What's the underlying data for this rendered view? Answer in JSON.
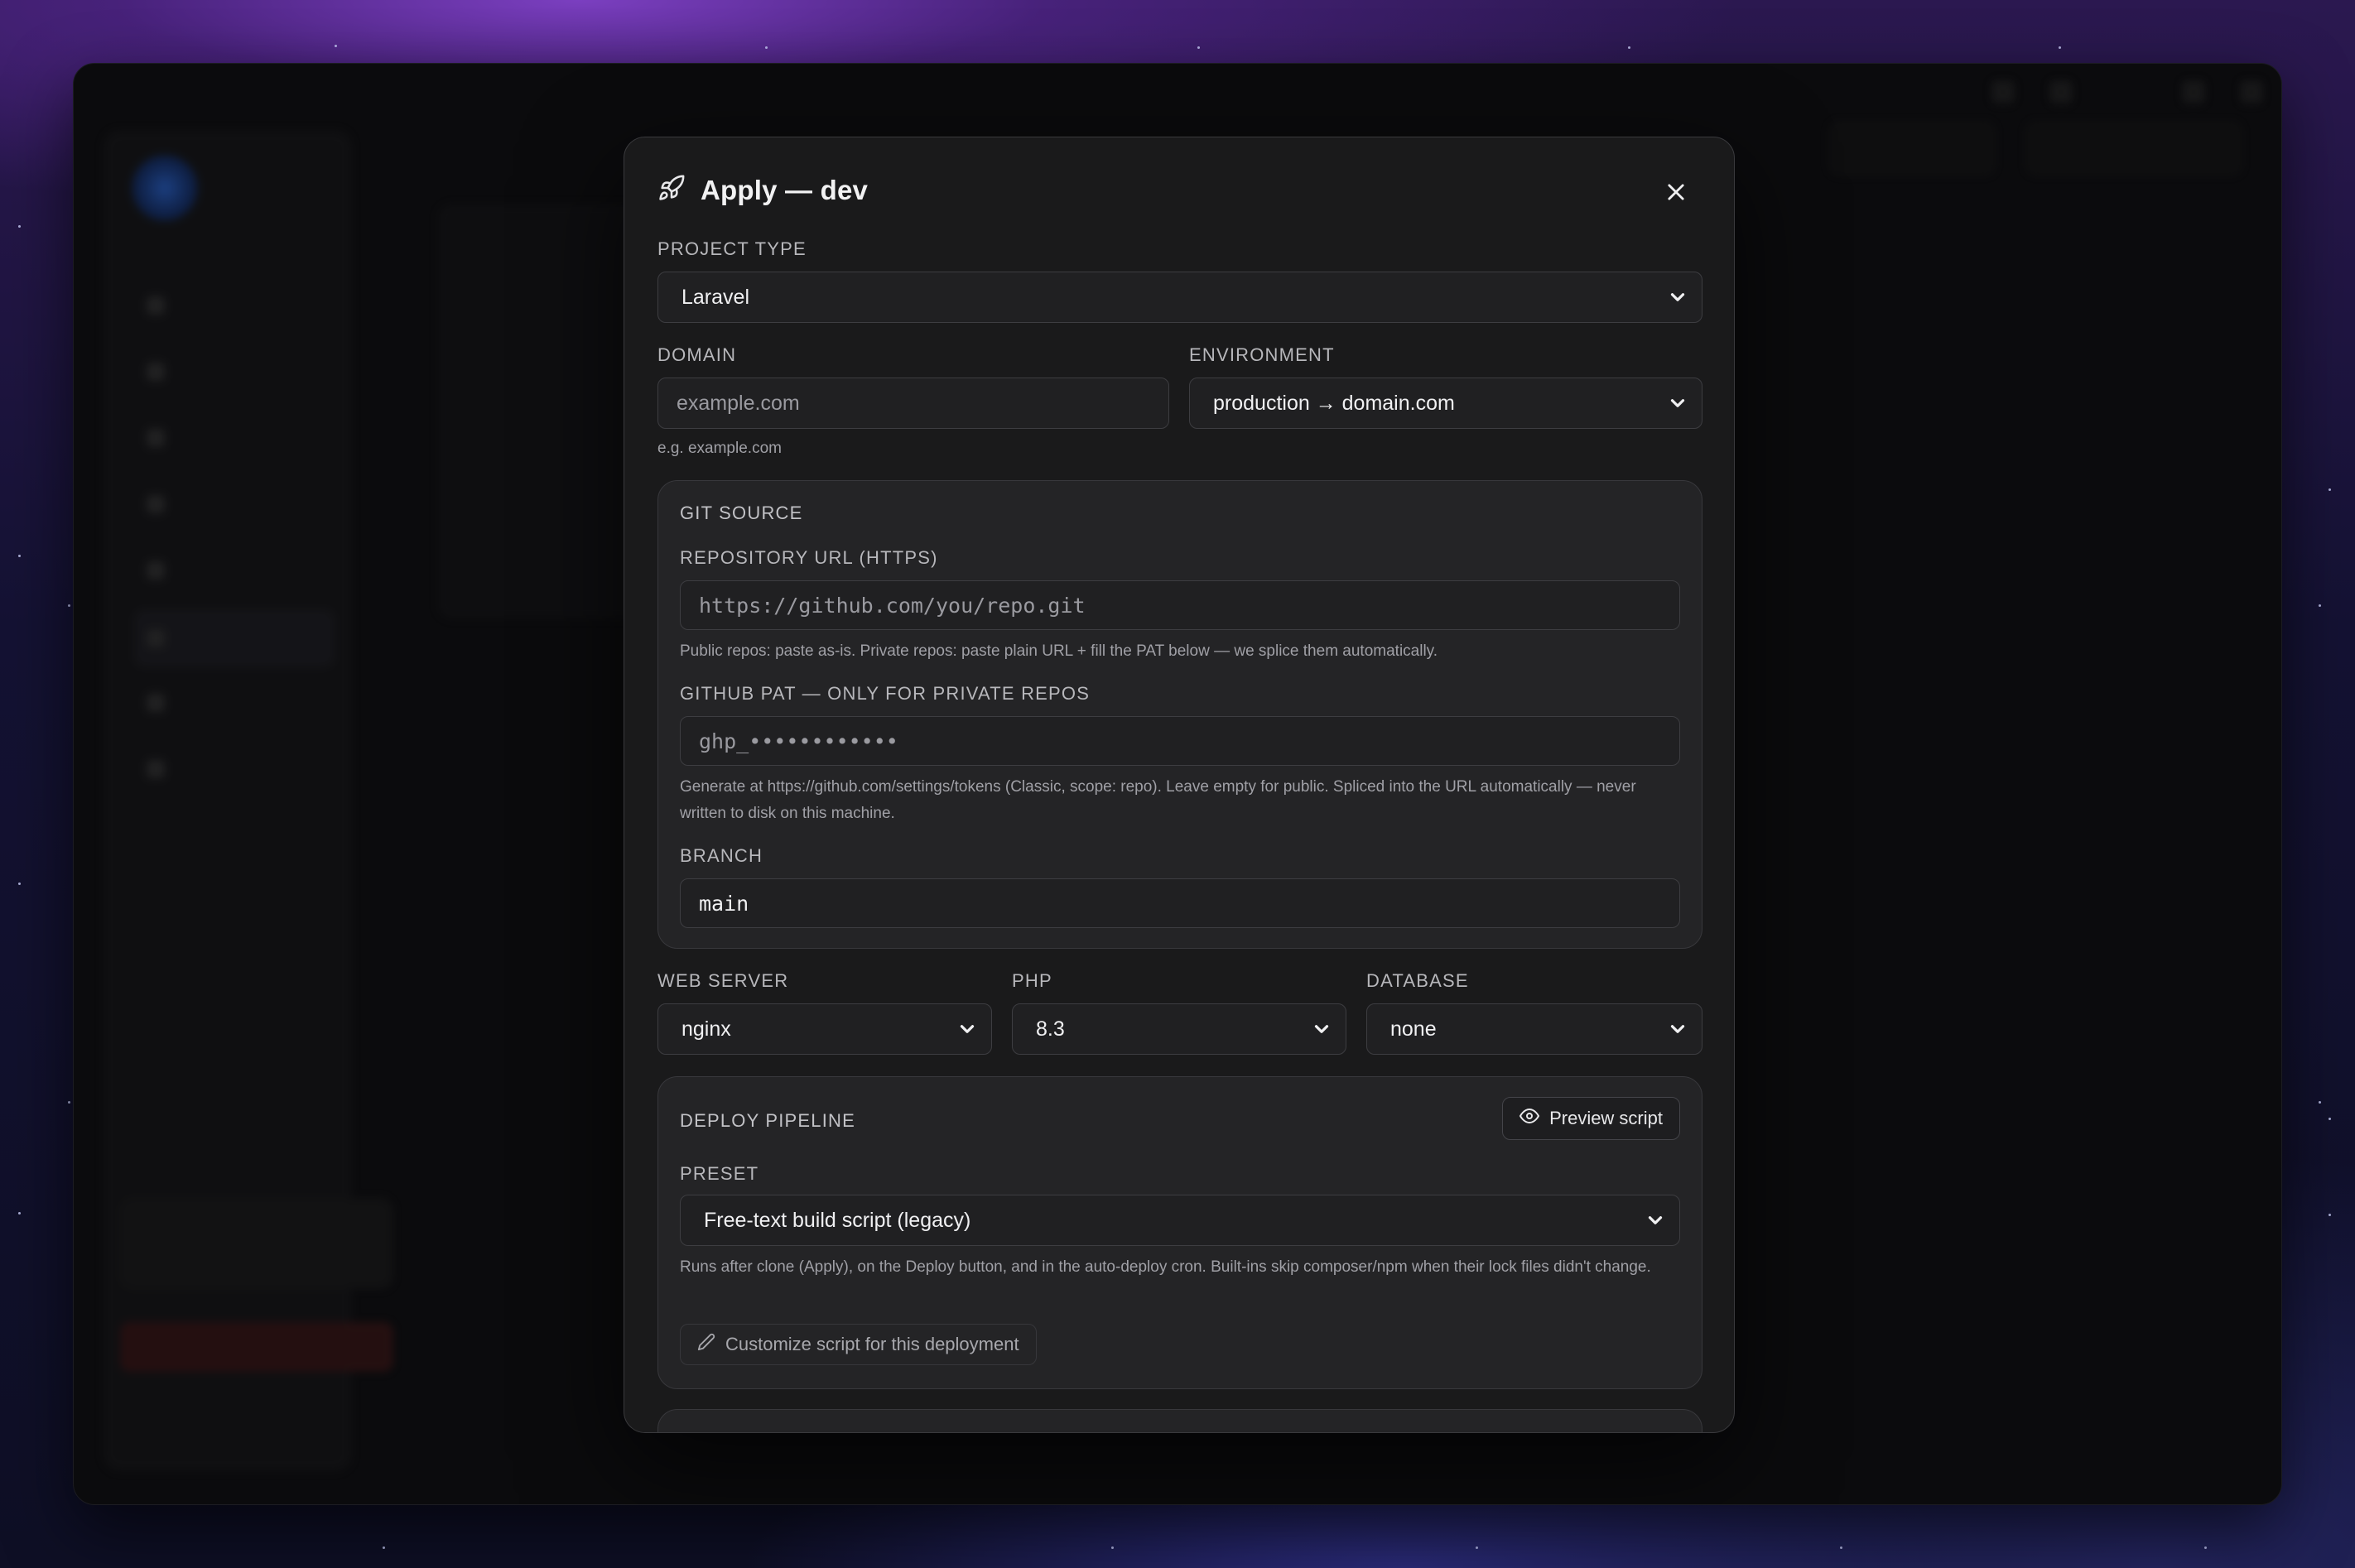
{
  "modal": {
    "title": "Apply — dev",
    "icon": "rocket-icon",
    "project_type": {
      "label": "PROJECT TYPE",
      "value": "Laravel"
    },
    "domain": {
      "label": "DOMAIN",
      "placeholder": "example.com",
      "hint": "e.g. example.com"
    },
    "environment": {
      "label": "ENVIRONMENT",
      "value": "production → domain.com"
    },
    "git_source": {
      "title": "GIT SOURCE",
      "repo_url": {
        "label": "REPOSITORY URL (HTTPS)",
        "placeholder": "https://github.com/you/repo.git",
        "hint": "Public repos: paste as-is. Private repos: paste plain URL + fill the PAT below — we splice them automatically."
      },
      "pat": {
        "label": "GITHUB PAT — ONLY FOR PRIVATE REPOS",
        "placeholder": "ghp_••••••••••••",
        "hint": "Generate at https://github.com/settings/tokens (Classic, scope: repo). Leave empty for public. Spliced into the URL automatically — never written to disk on this machine."
      },
      "branch": {
        "label": "BRANCH",
        "value": "main"
      }
    },
    "web_server": {
      "label": "WEB SERVER",
      "value": "nginx"
    },
    "php": {
      "label": "PHP",
      "value": "8.3"
    },
    "database": {
      "label": "DATABASE",
      "value": "none"
    },
    "deploy_pipeline": {
      "title": "DEPLOY PIPELINE",
      "preview_button": "Preview script",
      "preset": {
        "label": "PRESET",
        "value": "Free-text build script (legacy)"
      },
      "hint": "Runs after clone (Apply), on the Deploy button, and in the auto-deploy cron. Built-ins skip composer/npm when their lock files didn't change.",
      "customize_button": "Customize script for this deployment"
    }
  },
  "colors": {
    "modal_bg": "#1a1a1b",
    "panel_bg": "#242426",
    "border": "#3d3d41",
    "text": "#f0f0f2",
    "muted": "#a0a0a6"
  }
}
